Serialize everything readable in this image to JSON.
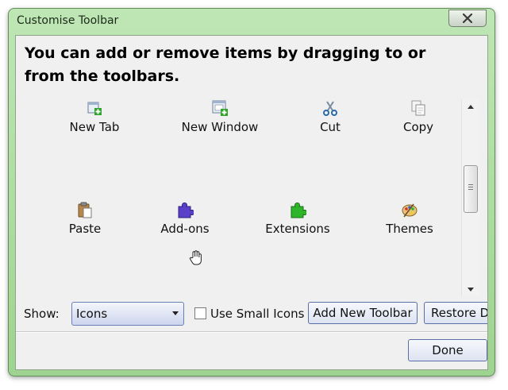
{
  "dialog": {
    "title": "Customise Toolbar",
    "heading": "You can add or remove items by dragging to or from the toolbars."
  },
  "palette": {
    "items": [
      {
        "label": "New Tab",
        "icon": "new-tab-icon"
      },
      {
        "label": "New Window",
        "icon": "new-window-icon"
      },
      {
        "label": "Cut",
        "icon": "scissors-icon"
      },
      {
        "label": "Copy",
        "icon": "copy-icon"
      },
      {
        "label": "Paste",
        "icon": "paste-icon"
      },
      {
        "label": "Add-ons",
        "icon": "addons-puzzle-icon"
      },
      {
        "label": "Extensions",
        "icon": "extensions-puzzle-icon"
      },
      {
        "label": "Themes",
        "icon": "palette-icon"
      }
    ]
  },
  "controls": {
    "show_label": "Show:",
    "show_value": "Icons",
    "small_icons_label": "Use Small Icons",
    "small_icons_checked": false,
    "add_toolbar_label": "Add New Toolbar",
    "restore_label": "Restore De",
    "done_label": "Done"
  },
  "colors": {
    "frame": "#9fd391",
    "client_bg": "#f0f0f0",
    "button_border": "#5a6fa8",
    "puzzle_addons": "#5a3fc8",
    "puzzle_extensions": "#2fb52a"
  }
}
